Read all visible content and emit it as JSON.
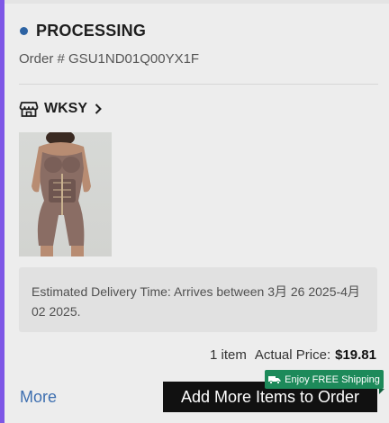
{
  "order": {
    "status": "PROCESSING",
    "order_number_line": "Order # GSU1ND01Q00YX1F"
  },
  "store": {
    "name": "WKSY",
    "icon": "store-icon"
  },
  "product": {
    "image": "shapewear-bodysuit-product-photo"
  },
  "delivery": {
    "text": "Estimated Delivery Time: Arrives between 3月 26 2025-4月 02 2025."
  },
  "summary": {
    "item_count": "1 item",
    "price_label": "Actual Price:",
    "price_value": "$19.81"
  },
  "actions": {
    "more_label": "More",
    "add_items_label": "Add More Items to Order",
    "free_shipping_label": "Enjoy FREE Shipping"
  },
  "colors": {
    "status_dot": "#2d63a3",
    "link": "#3e6fb0",
    "shipping_badge": "#1d8a5a",
    "primary_button": "#111111",
    "accent_edge": "#7e57e6"
  }
}
